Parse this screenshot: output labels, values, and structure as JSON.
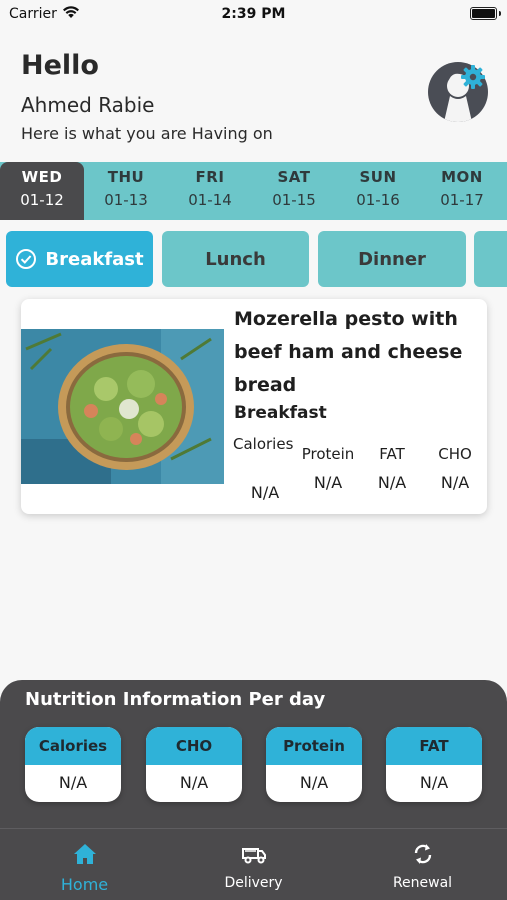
{
  "status_bar": {
    "carrier": "Carrier",
    "time": "2:39 PM"
  },
  "greeting": {
    "hello": "Hello",
    "user_name": "Ahmed Rabie",
    "subtitle": "Here is what you are Having on"
  },
  "days": [
    {
      "name": "WED",
      "date": "01-12",
      "selected": true
    },
    {
      "name": "THU",
      "date": "01-13"
    },
    {
      "name": "FRI",
      "date": "01-14"
    },
    {
      "name": "SAT",
      "date": "01-15"
    },
    {
      "name": "SUN",
      "date": "01-16"
    },
    {
      "name": "MON",
      "date": "01-17"
    }
  ],
  "meal_tabs": [
    {
      "label": "Breakfast",
      "selected": true
    },
    {
      "label": "Lunch"
    },
    {
      "label": "Dinner"
    },
    {
      "label": ""
    }
  ],
  "meal": {
    "title": "Mozerella pesto with beef ham and cheese bread",
    "type": "Breakfast",
    "nutrients": [
      {
        "label": "Calories",
        "value": "N/A"
      },
      {
        "label": "Protein",
        "value": "N/A"
      },
      {
        "label": "FAT",
        "value": "N/A"
      },
      {
        "label": "CHO",
        "value": "N/A"
      }
    ]
  },
  "daily_nutrition": {
    "title": "Nutrition Information Per day",
    "items": [
      {
        "label": "Calories",
        "value": "N/A"
      },
      {
        "label": "CHO",
        "value": "N/A"
      },
      {
        "label": "Protein",
        "value": "N/A"
      },
      {
        "label": "FAT",
        "value": "N/A"
      }
    ]
  },
  "tab_bar": {
    "items": [
      {
        "label": "Home",
        "icon": "home-icon",
        "active": true
      },
      {
        "label": "Delivery",
        "icon": "delivery-van-icon"
      },
      {
        "label": "Renewal",
        "icon": "refresh-icon"
      }
    ]
  },
  "colors": {
    "teal": "#6cc6c9",
    "accent": "#2fb2d8",
    "dark": "#4b4a4c"
  }
}
